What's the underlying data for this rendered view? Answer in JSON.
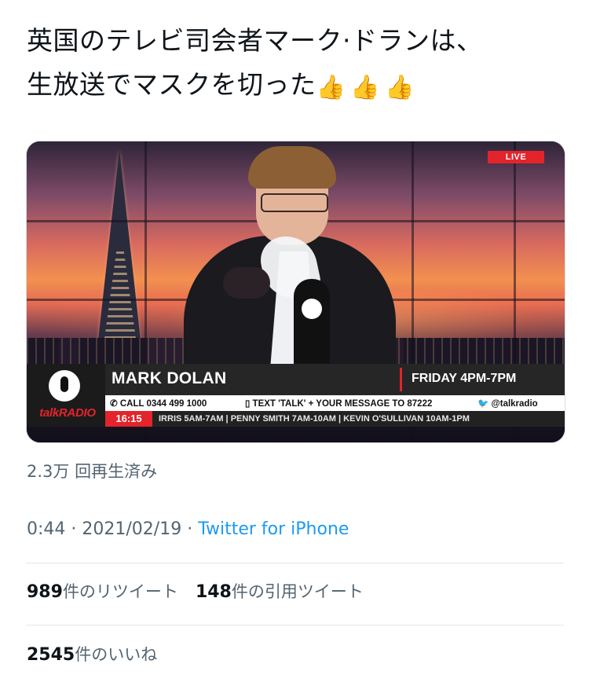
{
  "tweet": {
    "text_line1": "英国のテレビ司会者マーク·ドランは、",
    "text_line2": "生放送でマスクを切った",
    "emoji": [
      "👍",
      "👍",
      "👍"
    ]
  },
  "video": {
    "live_label": "LIVE",
    "presenter_name": "MARK DOLAN",
    "show_time": "FRIDAY 4PM-7PM",
    "call_text": "CALL 0344 499 1000",
    "text_info": "TEXT 'TALK' + YOUR MESSAGE TO 87222",
    "twitter_handle": "@talkradio",
    "clock": "16:15",
    "ticker": "IRRIS 5AM-7AM  |  PENNY SMITH 7AM-10AM  |  KEVIN O'SULLIVAN 10AM-1PM",
    "station_logo": "talkRADIO",
    "icons": [
      "phone-icon",
      "mobile-icon",
      "twitter-bird-icon",
      "microphone-icon"
    ]
  },
  "views": "2.3万 回再生済み",
  "meta": {
    "time": "0:44",
    "date": "2021/02/19",
    "separator": " · ",
    "client": "Twitter for iPhone"
  },
  "stats": {
    "retweets_count": "989",
    "retweets_label": "件のリツイート",
    "quotes_count": "148",
    "quotes_label": "件の引用ツイート",
    "likes_count": "2545",
    "likes_label": "件のいいね"
  },
  "colors": {
    "text": "#0f1419",
    "secondary": "#536471",
    "link": "#1d9bf0",
    "live_red": "#e3242b"
  }
}
